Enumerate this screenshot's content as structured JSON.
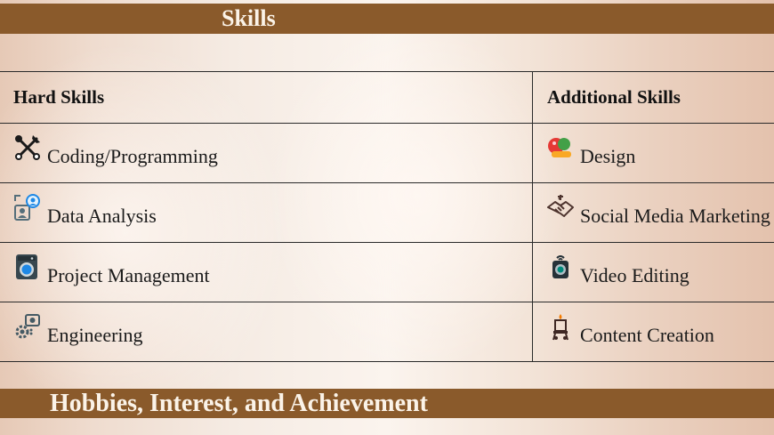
{
  "sections": {
    "skills_title": "Skills",
    "hobbies_title": "Hobbies, Interest, and Achievement"
  },
  "table": {
    "headers": {
      "hard": "Hard Skills",
      "additional": "Additional Skills"
    },
    "rows": [
      {
        "hard": {
          "label": "Coding/Programming",
          "icon": "crossed-tools-icon"
        },
        "additional": {
          "label": "Design",
          "icon": "design-palette-icon"
        }
      },
      {
        "hard": {
          "label": "Data Analysis",
          "icon": "user-data-icon"
        },
        "additional": {
          "label": "Social Media Marketing",
          "icon": "handshake-icon"
        }
      },
      {
        "hard": {
          "label": "Project Management",
          "icon": "washing-machine-icon"
        },
        "additional": {
          "label": "Video Editing",
          "icon": "camera-device-icon"
        }
      },
      {
        "hard": {
          "label": "Engineering",
          "icon": "gears-icon"
        },
        "additional": {
          "label": "Content Creation",
          "icon": "easel-icon"
        }
      }
    ]
  },
  "colors": {
    "band": "#8a5a2b",
    "band_text": "#fbf3e8",
    "border": "#2a2a2a",
    "text": "#1a1a1a"
  }
}
